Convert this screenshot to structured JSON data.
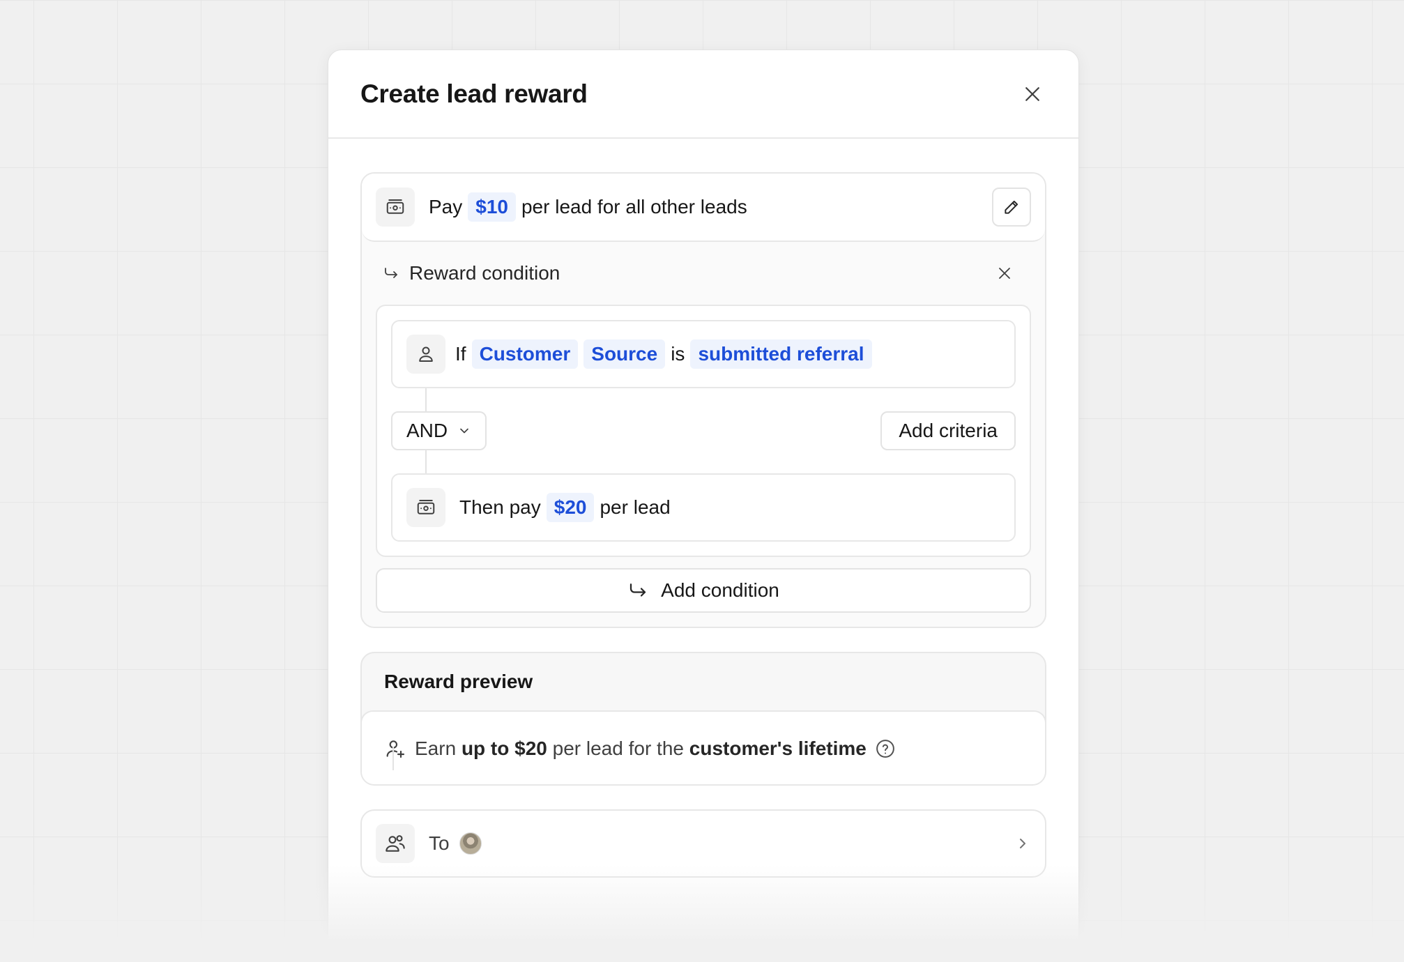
{
  "modal": {
    "title": "Create lead reward"
  },
  "reward": {
    "prefix": "Pay",
    "amount": "$10",
    "suffix": "per lead for all other leads"
  },
  "condition": {
    "title": "Reward condition",
    "criteria": {
      "if_label": "If",
      "entity": "Customer",
      "attribute": "Source",
      "operator": "is",
      "value": "submitted referral"
    },
    "logic": "AND",
    "add_criteria_label": "Add criteria",
    "then": {
      "prefix": "Then pay",
      "amount": "$20",
      "suffix": "per lead"
    },
    "add_condition_label": "Add condition"
  },
  "preview": {
    "title": "Reward preview",
    "earn": "Earn",
    "bold_amount": "up to $20",
    "mid": "per lead for the",
    "bold_duration": "customer's lifetime"
  },
  "to": {
    "label": "To"
  },
  "colors": {
    "accent": "#1d4ed8",
    "pill_bg": "#eef3fd"
  }
}
